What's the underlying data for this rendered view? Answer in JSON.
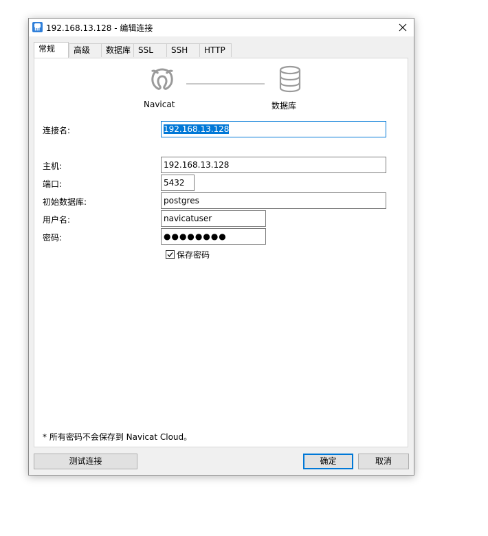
{
  "window": {
    "title": "192.168.13.128 - 编辑连接",
    "accent_color": "#0078d7",
    "icons": [
      "navicat-elephant-icon",
      "close-icon"
    ]
  },
  "tabs": [
    {
      "label": "常规",
      "active": true
    },
    {
      "label": "高级",
      "active": false
    },
    {
      "label": "数据库",
      "active": false
    },
    {
      "label": "SSL",
      "active": false
    },
    {
      "label": "SSH",
      "active": false
    },
    {
      "label": "HTTP",
      "active": false
    }
  ],
  "diagram": {
    "left_caption": "Navicat",
    "right_caption": "数据库",
    "icons": [
      "navicat-logo-icon",
      "database-icon"
    ]
  },
  "form": {
    "connection_name": {
      "label": "连接名:",
      "value": "192.168.13.128"
    },
    "host": {
      "label": "主机:",
      "value": "192.168.13.128"
    },
    "port": {
      "label": "端口:",
      "value": "5432"
    },
    "initial_database": {
      "label": "初始数据库:",
      "value": "postgres"
    },
    "username": {
      "label": "用户名:",
      "value": "navicatuser"
    },
    "password": {
      "label": "密码:",
      "masked": "●●●●●●●●"
    },
    "save_password": {
      "label": "保存密码",
      "checked": true
    }
  },
  "note": "* 所有密码不会保存到 Navicat Cloud。",
  "buttons": {
    "test": "测试连接",
    "ok": "确定",
    "cancel": "取消"
  }
}
